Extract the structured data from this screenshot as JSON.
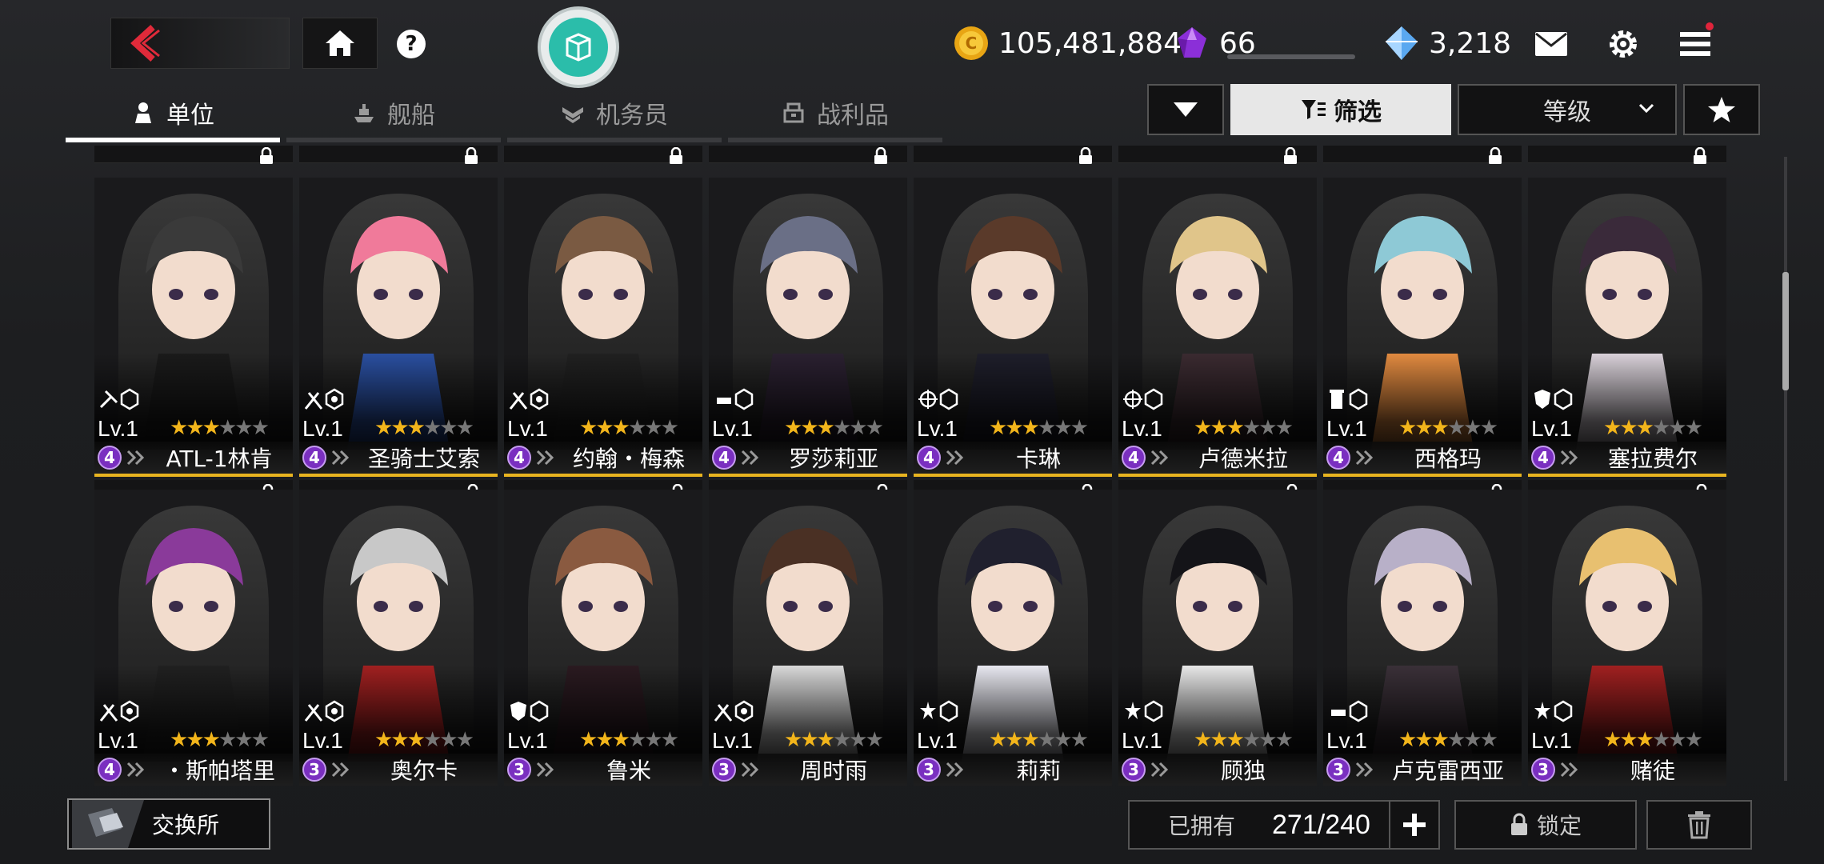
{
  "currencies": {
    "gold": "105,481,884",
    "gem": "66",
    "crystal": "3,218"
  },
  "tabs": [
    {
      "label": "单位",
      "icon": "person-icon",
      "active": true
    },
    {
      "label": "舰船",
      "icon": "ship-icon",
      "active": false
    },
    {
      "label": "机务员",
      "icon": "wings-icon",
      "active": false
    },
    {
      "label": "战利品",
      "icon": "loot-icon",
      "active": false
    }
  ],
  "filter": {
    "filter_label": "筛选",
    "sort_label": "等级"
  },
  "units_row1": [
    {
      "name": "ATL-1林肯",
      "level": "Lv.1",
      "rank": "4",
      "stars": 3,
      "role": "tank-class-icon",
      "palette": [
        "#3a3a3a",
        "#1a1a1a"
      ]
    },
    {
      "name": "圣骑士艾索",
      "level": "Lv.1",
      "rank": "4",
      "stars": 3,
      "role": "striker-class-icon",
      "palette": [
        "#f07a9a",
        "#2a4fa0"
      ]
    },
    {
      "name": "约翰・梅森",
      "level": "Lv.1",
      "rank": "4",
      "stars": 3,
      "role": "striker-class-icon",
      "palette": [
        "#7a5a42",
        "#202020"
      ]
    },
    {
      "name": "罗莎莉亚",
      "level": "Lv.1",
      "rank": "4",
      "stars": 3,
      "role": "ranger-class-icon",
      "palette": [
        "#6a6f86",
        "#2a2030"
      ]
    },
    {
      "name": "卡琳",
      "level": "Lv.1",
      "rank": "4",
      "stars": 3,
      "role": "sniper-class-icon",
      "palette": [
        "#5a3a2a",
        "#1e1e2a"
      ]
    },
    {
      "name": "卢德米拉",
      "level": "Lv.1",
      "rank": "4",
      "stars": 3,
      "role": "sniper-class-icon",
      "palette": [
        "#e0c58a",
        "#3a2a30"
      ]
    },
    {
      "name": "西格玛",
      "level": "Lv.1",
      "rank": "4",
      "stars": 3,
      "role": "tower-class-icon",
      "palette": [
        "#8ec9d6",
        "#e08a40"
      ]
    },
    {
      "name": "塞拉费尔",
      "level": "Lv.1",
      "rank": "4",
      "stars": 3,
      "role": "defender-class-icon",
      "palette": [
        "#3a2a3a",
        "#d8d0d8"
      ]
    }
  ],
  "units_row2": [
    {
      "name": "・斯帕塔里",
      "level": "Lv.1",
      "rank": "4",
      "stars": 3,
      "role": "striker-class-icon",
      "palette": [
        "#8a3a9a",
        "#202020"
      ]
    },
    {
      "name": "奥尔卡",
      "level": "Lv.1",
      "rank": "3",
      "stars": 3,
      "role": "striker-class-icon",
      "palette": [
        "#c8c8c8",
        "#a02020"
      ]
    },
    {
      "name": "鲁米",
      "level": "Lv.1",
      "rank": "3",
      "stars": 3,
      "role": "defender-class-icon",
      "palette": [
        "#8a5a40",
        "#2a1a20"
      ]
    },
    {
      "name": "周时雨",
      "level": "Lv.1",
      "rank": "3",
      "stars": 3,
      "role": "striker-class-icon",
      "palette": [
        "#4a3024",
        "#d8d8d8"
      ]
    },
    {
      "name": "莉莉",
      "level": "Lv.1",
      "rank": "3",
      "stars": 3,
      "role": "supporter-class-icon",
      "palette": [
        "#20202e",
        "#e8e8f0"
      ]
    },
    {
      "name": "顾独",
      "level": "Lv.1",
      "rank": "3",
      "stars": 3,
      "role": "supporter-class-icon",
      "palette": [
        "#141418",
        "#e8e8e8"
      ]
    },
    {
      "name": "卢克雷西亚",
      "level": "Lv.1",
      "rank": "3",
      "stars": 3,
      "role": "ranger-class-icon",
      "palette": [
        "#b8b0c8",
        "#3a3038"
      ]
    },
    {
      "name": "赌徒",
      "level": "Lv.1",
      "rank": "3",
      "stars": 3,
      "role": "supporter-class-icon",
      "palette": [
        "#e8c070",
        "#a02020"
      ]
    }
  ],
  "bottom": {
    "exchange_label": "交换所",
    "owned_label": "已拥有",
    "owned_count": "271/240",
    "lock_label": "锁定"
  },
  "colors": {
    "accent_gold": "#e8b420",
    "rank_purple": "#7a2fc0",
    "notification": "#e0243b"
  }
}
